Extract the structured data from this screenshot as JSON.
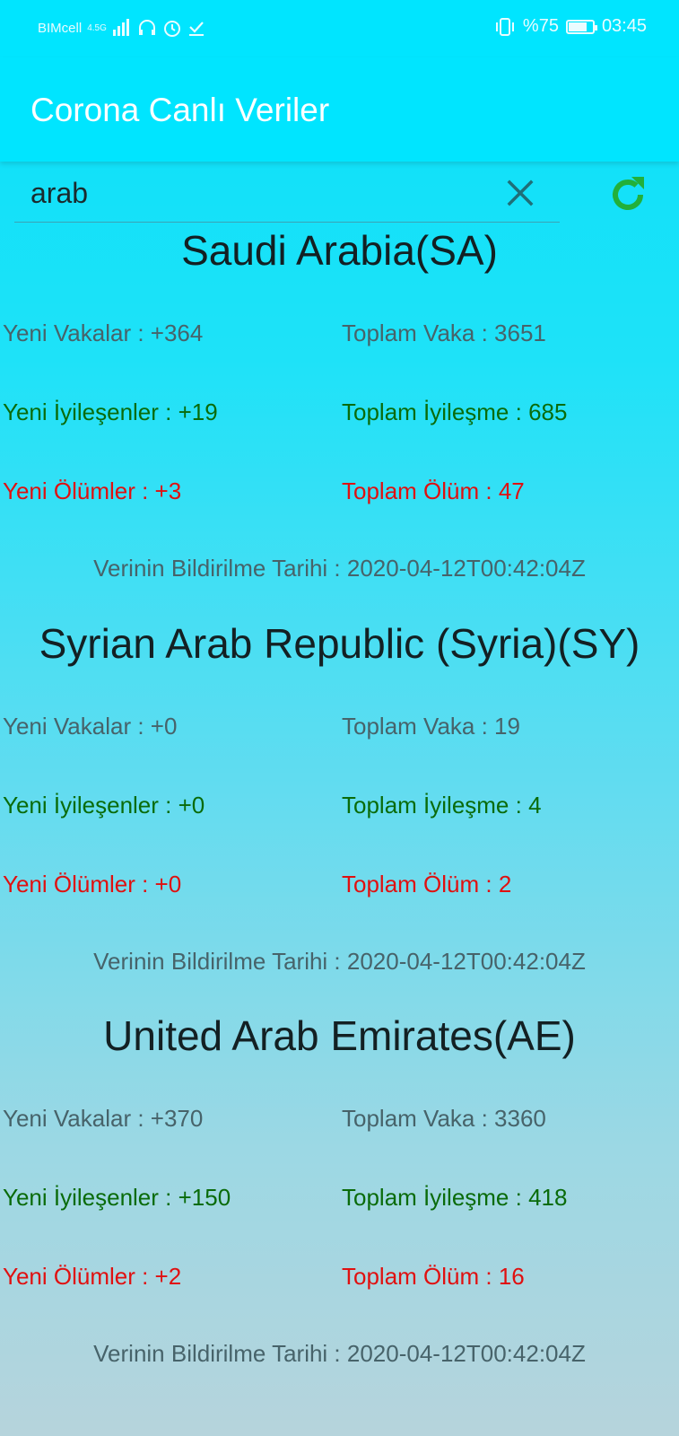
{
  "status_bar": {
    "carrier": "BIMcell",
    "network": "4.5G",
    "battery": "%75",
    "time": "03:45"
  },
  "app_bar": {
    "title": "Corona Canlı Veriler"
  },
  "search": {
    "value": "arab"
  },
  "countries": [
    {
      "name": "Saudi Arabia(SA)",
      "new_cases": "Yeni Vakalar : +364",
      "total_cases": "Toplam Vaka : 3651",
      "new_recovered": "Yeni İyileşenler : +19",
      "total_recovered": "Toplam İyileşme : 685",
      "new_deaths": "Yeni Ölümler : +3",
      "total_deaths": "Toplam Ölüm : 47",
      "date": "Verinin Bildirilme Tarihi : 2020-04-12T00:42:04Z"
    },
    {
      "name": "Syrian Arab Republic (Syria)(SY)",
      "new_cases": "Yeni Vakalar : +0",
      "total_cases": "Toplam Vaka : 19",
      "new_recovered": "Yeni İyileşenler : +0",
      "total_recovered": "Toplam İyileşme : 4",
      "new_deaths": "Yeni Ölümler : +0",
      "total_deaths": "Toplam Ölüm : 2",
      "date": "Verinin Bildirilme Tarihi : 2020-04-12T00:42:04Z"
    },
    {
      "name": "United Arab Emirates(AE)",
      "new_cases": "Yeni Vakalar : +370",
      "total_cases": "Toplam Vaka : 3360",
      "new_recovered": "Yeni İyileşenler : +150",
      "total_recovered": "Toplam İyileşme : 418",
      "new_deaths": "Yeni Ölümler : +2",
      "total_deaths": "Toplam Ölüm : 16",
      "date": "Verinin Bildirilme Tarihi : 2020-04-12T00:42:04Z"
    }
  ],
  "icons": {
    "clear": "close-icon",
    "refresh": "refresh-icon"
  },
  "colors": {
    "appbar": "#00e5ff",
    "recovered": "#0a6b0a",
    "deaths": "#e01010",
    "refresh": "#22b03a"
  }
}
